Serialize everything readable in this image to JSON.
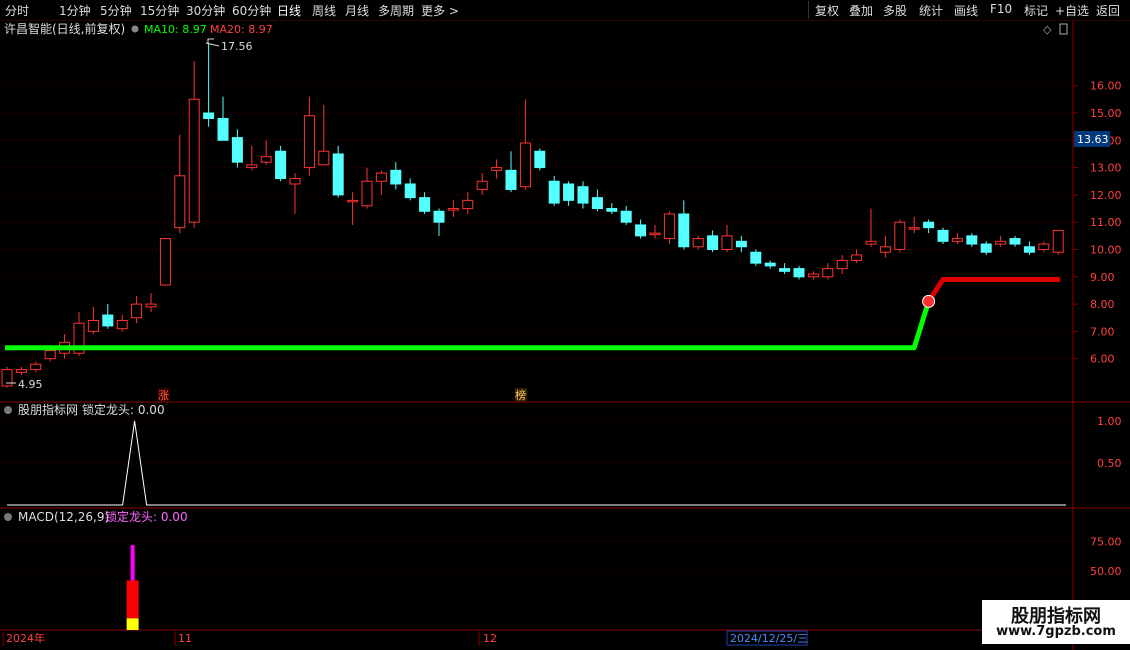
{
  "toolbar": {
    "periods": [
      "分时",
      "1分钟",
      "5分钟",
      "15分钟",
      "30分钟",
      "60分钟",
      "日线",
      "周线",
      "月线",
      "多周期",
      "更多 >"
    ],
    "active": "日线",
    "right": [
      "复权",
      "叠加",
      "多股",
      "统计",
      "画线",
      "F10",
      "标记",
      "+自选",
      "返回"
    ]
  },
  "stock": {
    "name_label": "许昌智能(日线,前复权)",
    "ma10_label": "MA10: 8.97",
    "ma20_label": "MA20: 8.97",
    "last_price": "13.63",
    "high_label": "17.56",
    "low_label": "4.95",
    "tags": [
      "涨",
      "榜"
    ]
  },
  "panel2": {
    "title": "股朋指标网",
    "series_label": "锁定龙头: 0.00"
  },
  "panel3": {
    "title": "MACD(12,26,9)",
    "series_label": "锁定龙头: 0.00"
  },
  "date_axis": {
    "labels": [
      "2024年",
      "11",
      "12"
    ],
    "cursor_label": "2024/12/25/三"
  },
  "watermark": {
    "line1": "股朋指标网",
    "line2": "www.7gpzb.com"
  },
  "colors": {
    "up": "#ff3232",
    "down": "#54ffff",
    "line_green": "#00ff00",
    "line_red": "#dd0000",
    "grid": "#5a0000",
    "ma10": "#00ff00",
    "ma20": "#ff4040"
  },
  "chart_data": [
    {
      "type": "candlestick",
      "yticks": [
        6,
        7,
        8,
        9,
        10,
        11,
        12,
        13,
        14,
        15,
        16
      ],
      "ylim": [
        4.4,
        17.8
      ],
      "candles": [
        [
          5.0,
          5.6,
          5.7,
          4.95
        ],
        [
          5.5,
          5.6,
          5.7,
          5.4
        ],
        [
          5.6,
          5.8,
          5.9,
          5.5
        ],
        [
          6.0,
          6.3,
          6.5,
          5.9
        ],
        [
          6.2,
          6.6,
          6.9,
          6.0
        ],
        [
          6.2,
          7.3,
          7.7,
          6.1
        ],
        [
          7.0,
          7.4,
          7.9,
          6.9
        ],
        [
          7.6,
          7.2,
          8.0,
          7.1
        ],
        [
          7.1,
          7.4,
          7.6,
          7.0
        ],
        [
          7.5,
          8.0,
          8.3,
          7.3
        ],
        [
          7.9,
          8.0,
          8.4,
          7.7
        ],
        [
          8.7,
          10.4,
          10.4,
          8.7
        ],
        [
          10.8,
          12.7,
          14.2,
          10.6
        ],
        [
          11.0,
          15.5,
          16.9,
          10.8
        ],
        [
          15.0,
          14.8,
          17.56,
          14.5
        ],
        [
          14.8,
          14.0,
          15.6,
          14.2
        ],
        [
          14.1,
          13.2,
          14.4,
          13.0
        ],
        [
          13.0,
          13.1,
          13.8,
          12.9
        ],
        [
          13.2,
          13.4,
          14.0,
          13.1
        ],
        [
          13.6,
          12.6,
          13.8,
          12.5
        ],
        [
          12.4,
          12.6,
          12.8,
          11.3
        ],
        [
          13.0,
          14.9,
          15.6,
          12.7
        ],
        [
          13.1,
          13.6,
          15.3,
          13.3
        ],
        [
          13.5,
          12.0,
          13.8,
          11.9
        ],
        [
          11.8,
          11.8,
          12.1,
          10.9
        ],
        [
          11.6,
          12.5,
          13.0,
          11.5
        ],
        [
          12.5,
          12.8,
          12.9,
          12.0
        ],
        [
          12.9,
          12.4,
          13.2,
          12.2
        ],
        [
          12.4,
          11.9,
          12.6,
          11.8
        ],
        [
          11.9,
          11.4,
          12.1,
          11.3
        ],
        [
          11.4,
          11.0,
          11.5,
          10.5
        ],
        [
          11.5,
          11.5,
          11.8,
          11.2
        ],
        [
          11.5,
          11.8,
          12.1,
          11.3
        ],
        [
          12.2,
          12.5,
          12.8,
          12.0
        ],
        [
          12.9,
          13.0,
          13.3,
          12.6
        ],
        [
          12.9,
          12.2,
          13.6,
          12.1
        ],
        [
          12.3,
          13.9,
          15.5,
          12.2
        ],
        [
          13.6,
          13.0,
          13.7,
          12.9
        ],
        [
          12.5,
          11.7,
          12.7,
          11.6
        ],
        [
          12.4,
          11.8,
          12.5,
          11.6
        ],
        [
          12.3,
          11.7,
          12.5,
          11.5
        ],
        [
          11.9,
          11.5,
          12.2,
          11.4
        ],
        [
          11.5,
          11.4,
          11.7,
          11.3
        ],
        [
          11.4,
          11.0,
          11.6,
          10.9
        ],
        [
          10.9,
          10.5,
          11.1,
          10.4
        ],
        [
          10.6,
          10.6,
          10.9,
          10.4
        ],
        [
          10.4,
          11.3,
          11.4,
          10.2
        ],
        [
          11.3,
          10.1,
          11.8,
          10.0
        ],
        [
          10.1,
          10.4,
          10.5,
          10.0
        ],
        [
          10.5,
          10.0,
          10.7,
          9.9
        ],
        [
          10.0,
          10.5,
          10.9,
          9.9
        ],
        [
          10.3,
          10.1,
          10.5,
          9.9
        ],
        [
          9.9,
          9.5,
          10.0,
          9.4
        ],
        [
          9.5,
          9.4,
          9.6,
          9.3
        ],
        [
          9.3,
          9.2,
          9.5,
          9.1
        ],
        [
          9.3,
          9.0,
          9.4,
          8.9
        ],
        [
          9.0,
          9.1,
          9.2,
          8.9
        ],
        [
          9.0,
          9.3,
          9.5,
          8.9
        ],
        [
          9.3,
          9.6,
          9.8,
          9.1
        ],
        [
          9.6,
          9.8,
          10.0,
          9.5
        ],
        [
          10.2,
          10.3,
          11.5,
          10.1
        ],
        [
          9.9,
          10.1,
          10.5,
          9.7
        ],
        [
          10.0,
          11.0,
          11.1,
          9.9
        ],
        [
          10.8,
          10.8,
          11.2,
          10.6
        ],
        [
          11.0,
          10.8,
          11.1,
          10.6
        ],
        [
          10.7,
          10.3,
          10.8,
          10.2
        ],
        [
          10.3,
          10.4,
          10.6,
          10.2
        ],
        [
          10.5,
          10.2,
          10.6,
          10.1
        ],
        [
          10.2,
          9.9,
          10.3,
          9.8
        ],
        [
          10.2,
          10.3,
          10.5,
          10.1
        ],
        [
          10.4,
          10.2,
          10.5,
          10.1
        ],
        [
          10.1,
          9.9,
          10.3,
          9.8
        ],
        [
          10.0,
          10.2,
          10.3,
          9.9
        ],
        [
          9.9,
          10.7,
          10.7,
          9.8
        ]
      ],
      "stop_line": {
        "green": {
          "from_index": 0,
          "to_index": 63,
          "value": 6.4,
          "rise_to": 8.1
        },
        "red": {
          "from_index": 65,
          "to_index": 73,
          "value": 8.9
        }
      }
    },
    {
      "type": "line",
      "yticks": [
        0.5,
        1.0
      ],
      "ylim": [
        -0.03,
        1.12
      ],
      "spike_index": 9,
      "values": "0 except 1.00 at spike_index"
    },
    {
      "type": "bar",
      "yticks": [
        50.0,
        75.0
      ],
      "bar_index": 9,
      "segments": [
        {
          "color": "#ffff00",
          "from": 0,
          "to": 10
        },
        {
          "color": "#ff0000",
          "from": 10,
          "to": 42
        },
        {
          "color": "#ff00ff",
          "from": 42,
          "to": 72
        }
      ]
    }
  ]
}
